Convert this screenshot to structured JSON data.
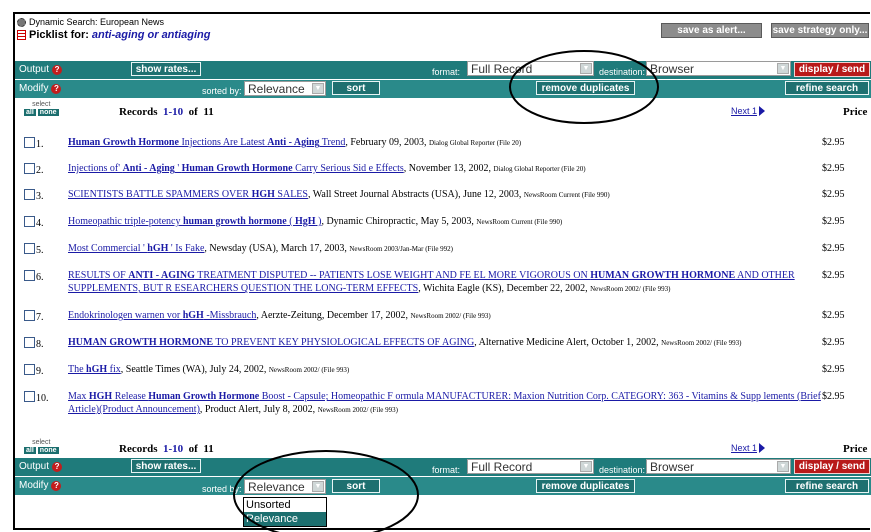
{
  "header": {
    "search_title": "Dynamic Search: European News",
    "picklist_label": "Picklist for:",
    "query": "anti-aging or antiaging",
    "save_alert": "save as alert...",
    "save_strategy": "save strategy only..."
  },
  "toolbar": {
    "output_label": "Output",
    "modify_label": "Modify",
    "help_glyph": "?",
    "show_rates": "show rates...",
    "format_label": "format:",
    "format_value": "Full Record",
    "destination_label": "destination:",
    "destination_value": "Browser",
    "display_send": "display / send",
    "sorted_by_label": "sorted by:",
    "sort_value": "Relevance",
    "sort_button": "sort",
    "remove_duplicates": "remove duplicates",
    "refine_search": "refine search"
  },
  "records": {
    "select_label": "select",
    "all": "all",
    "none": "none",
    "records_label": "Records",
    "range": "1-10",
    "of_label": "of",
    "total": "11",
    "next": "Next 1",
    "price_header": "Price"
  },
  "results": [
    {
      "num": "1.",
      "pre": "",
      "bold1": "Human Growth Hormone",
      "mid1": " Injections Are Latest ",
      "bold2": "Anti - Aging",
      "mid2": " Trend",
      "post": ", February 09, 2003, ",
      "src": "Dialog Global Reporter (File 20)",
      "price": "$2.95"
    },
    {
      "num": "2.",
      "pre": "Injections of' ",
      "bold1": "Anti - Aging",
      "mid1": " ' ",
      "bold2": "Human Growth Hormone",
      "mid2": " Carry Serious Sid e Effects",
      "post": ", November 13, 2002, ",
      "src": "Dialog Global Reporter (File 20)",
      "price": "$2.95"
    },
    {
      "num": "3.",
      "pre": "SCIENTISTS BATTLE SPAMMERS OVER ",
      "bold1": "HGH",
      "mid1": " SALES",
      "bold2": "",
      "mid2": "",
      "post": ", Wall Street Journal Abstracts (USA), June 12, 2003, ",
      "src": "NewsRoom Current (File 990)",
      "price": "$2.95"
    },
    {
      "num": "4.",
      "pre": "Homeopathic triple-potency ",
      "bold1": "human growth hormone",
      "mid1": " ( ",
      "bold2": "HgH",
      "mid2": " )",
      "post": ", Dynamic Chiropractic, May 5, 2003, ",
      "src": "NewsRoom Current (File 990)",
      "price": "$2.95"
    },
    {
      "num": "5.",
      "pre": "Most Commercial ' ",
      "bold1": "hGH",
      "mid1": " ' Is Fake",
      "bold2": "",
      "mid2": "",
      "post": ", Newsday (USA), March 17, 2003, ",
      "src": "NewsRoom 2003/Jan-Mar (File 992)",
      "price": "$2.95"
    },
    {
      "num": "6.",
      "pre": "RESULTS OF ",
      "bold1": "ANTI - AGING",
      "mid1": " TREATMENT DISPUTED -- PATIENTS LOSE WEIGHT AND FE EL MORE VIGOROUS ON ",
      "bold2": "HUMAN GROWTH HORMONE",
      "mid2": " AND OTHER SUPPLEMENTS, BUT R ESEARCHERS QUESTION THE LONG-TERM EFFECTS",
      "post": ", Wichita Eagle (KS), December 22, 2002, ",
      "src": "NewsRoom 2002/ (File 993)",
      "price": "$2.95"
    },
    {
      "num": "7.",
      "pre": "Endokrinologen warnen vor ",
      "bold1": "hGH",
      "mid1": " -Missbrauch",
      "bold2": "",
      "mid2": "",
      "post": ", Aerzte-Zeitung, December 17, 2002, ",
      "src": "NewsRoom 2002/ (File 993)",
      "price": "$2.95"
    },
    {
      "num": "8.",
      "pre": "",
      "bold1": "HUMAN GROWTH HORMONE",
      "mid1": " TO PREVENT KEY PHYSIOLOGICAL EFFECTS OF AGING",
      "bold2": "",
      "mid2": "",
      "post": ", Alternative Medicine Alert, October 1, 2002, ",
      "src": "NewsRoom 2002/ (File 993)",
      "price": "$2.95"
    },
    {
      "num": "9.",
      "pre": "The ",
      "bold1": "hGH",
      "mid1": " fix",
      "bold2": "",
      "mid2": "",
      "post": ", Seattle Times (WA), July 24, 2002, ",
      "src": "NewsRoom 2002/ (File 993)",
      "price": "$2.95"
    },
    {
      "num": "10.",
      "pre": "Max ",
      "bold1": "HGH",
      "mid1": " Release ",
      "bold2": "Human Growth Hormone",
      "mid2": " Boost - Capsule; Homeopathic F ormula MANUFACTURER: Maxion Nutrition Corp. CATEGORY: 363 - Vitamins & Supp lements (Brief Article)(Product Announcement)",
      "post": ", Product Alert, July 8, 2002, ",
      "src": "NewsRoom 2002/ (File 993)",
      "price": "$2.95"
    }
  ],
  "sort_dropdown": {
    "options": [
      "Unsorted",
      "Relevance"
    ],
    "selected": "Relevance"
  },
  "colors": {
    "teal_bar": "#1f7b7b",
    "red_button": "#b81a1a",
    "link": "#1a1aa6",
    "gray_button": "#8c8c8c"
  }
}
